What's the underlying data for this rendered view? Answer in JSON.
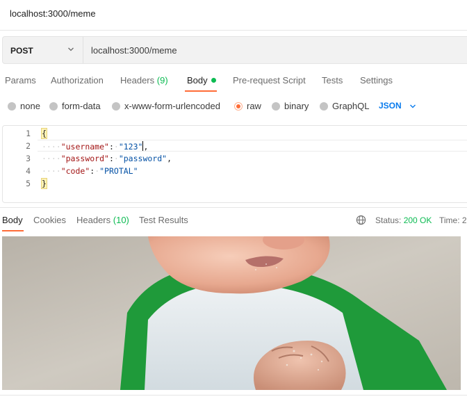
{
  "window": {
    "title": "localhost:3000/meme"
  },
  "request": {
    "method": "POST",
    "url": "localhost:3000/meme"
  },
  "request_tabs": [
    {
      "label": "Params"
    },
    {
      "label": "Authorization"
    },
    {
      "label": "Headers",
      "count": "(9)"
    },
    {
      "label": "Body",
      "active": true
    },
    {
      "label": "Pre-request Script"
    },
    {
      "label": "Tests"
    },
    {
      "label": "Settings"
    }
  ],
  "body_types": [
    {
      "label": "none"
    },
    {
      "label": "form-data"
    },
    {
      "label": "x-www-form-urlencoded"
    },
    {
      "label": "raw",
      "selected": true
    },
    {
      "label": "binary"
    },
    {
      "label": "GraphQL"
    }
  ],
  "raw_format": "JSON",
  "editor": {
    "line_numbers": [
      "1",
      "2",
      "3",
      "4",
      "5"
    ],
    "open_brace": "{",
    "close_brace": "}",
    "fields": [
      {
        "key": "\"username\"",
        "value": "\"123\"",
        "trailing": ","
      },
      {
        "key": "\"password\"",
        "value": "\"password\"",
        "trailing": ","
      },
      {
        "key": "\"code\"",
        "value": "\"PROTAL\"",
        "trailing": ""
      }
    ]
  },
  "response_tabs": [
    {
      "label": "Body",
      "active": true
    },
    {
      "label": "Cookies"
    },
    {
      "label": "Headers",
      "count": "(10)"
    },
    {
      "label": "Test Results"
    }
  ],
  "response_status": {
    "status_label": "Status:",
    "status_value": "200 OK",
    "time_label": "Time: 2"
  },
  "response_image": {
    "icon": "meme-image"
  },
  "colors": {
    "accent": "#ff6c37",
    "green": "#0cbb52",
    "link_blue": "#097bed"
  }
}
